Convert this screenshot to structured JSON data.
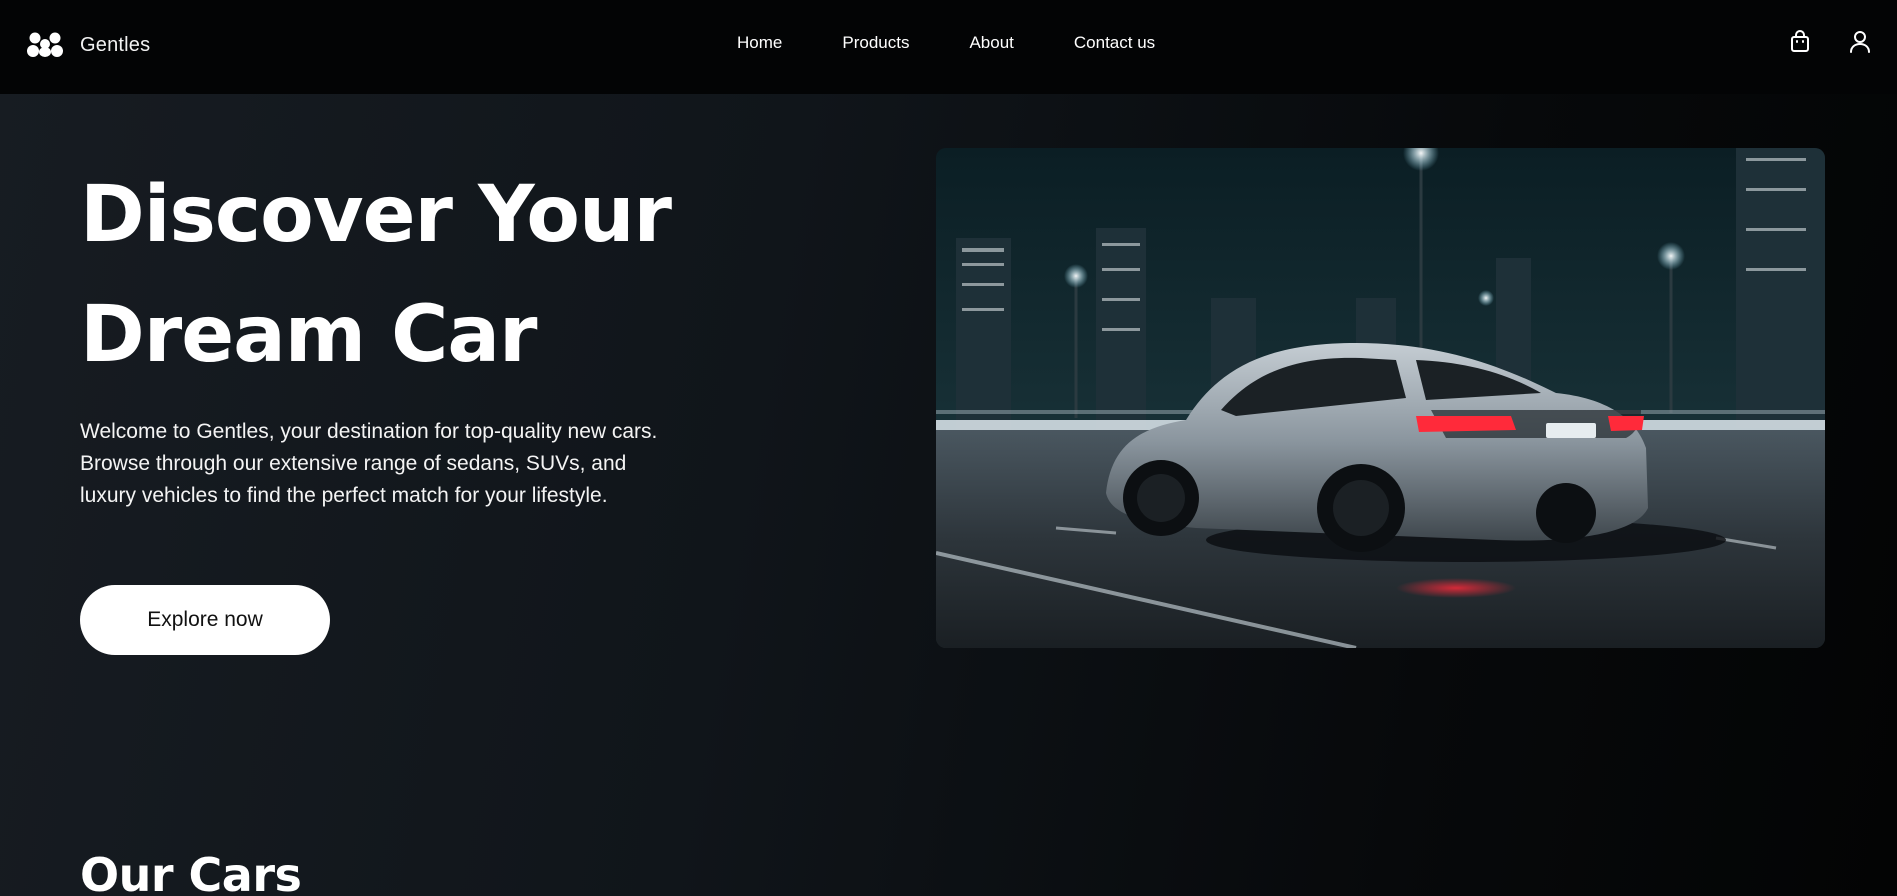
{
  "brand": {
    "name": "Gentles",
    "logo_icon": "brand-logo-icon"
  },
  "nav": {
    "links": [
      {
        "label": "Home"
      },
      {
        "label": "Products"
      },
      {
        "label": "About"
      },
      {
        "label": "Contact us"
      }
    ],
    "icons": {
      "cart": "shopping-bag-icon",
      "user": "user-icon"
    }
  },
  "hero": {
    "title_line1": "Discover Your",
    "title_line2": "Dream Car",
    "description": "Welcome to Gentles, your destination for top-quality new cars. Browse through our extensive range of sedans, SUVs, and luxury vehicles to find the perfect match for your lifestyle.",
    "cta_label": "Explore now",
    "image": "silver sports car on a city highway at night"
  },
  "sections": {
    "our_cars_title": "Our Cars"
  },
  "colors": {
    "nav_bg": "#030405",
    "page_bg": "#10151a",
    "cta_bg": "#ffffff",
    "text": "#ffffff"
  }
}
